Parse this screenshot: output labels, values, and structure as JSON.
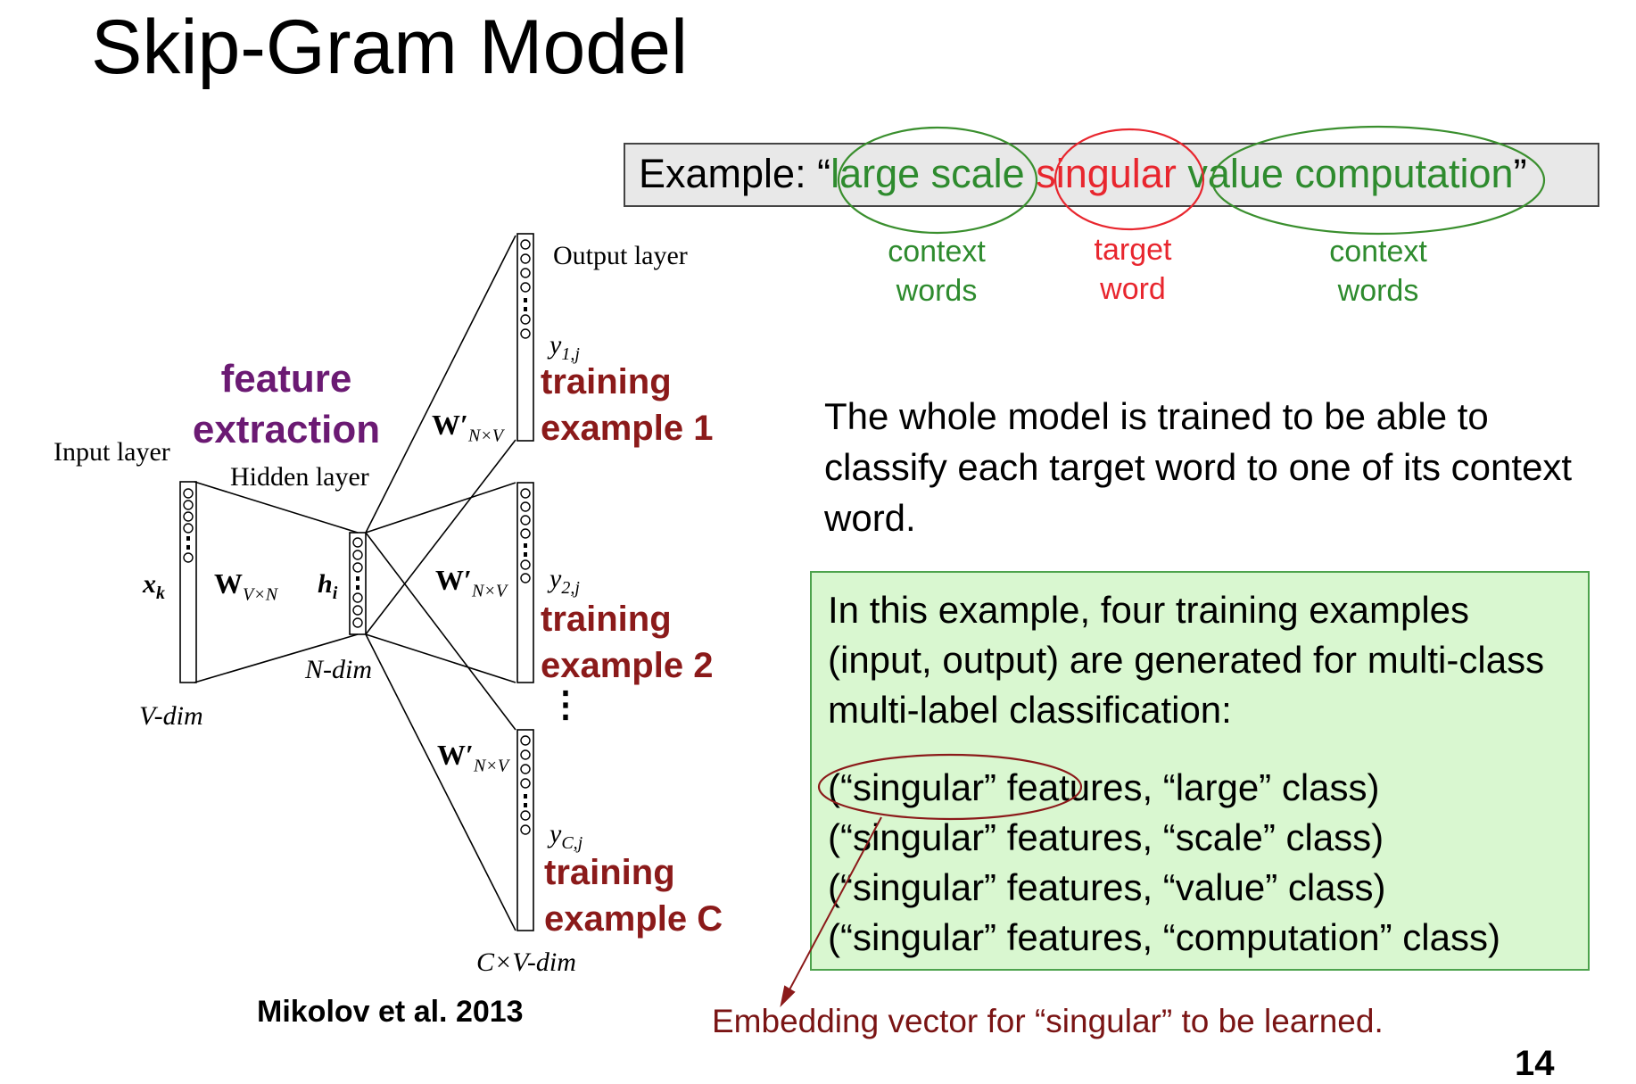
{
  "slide": {
    "title": "Skip-Gram Model",
    "example": {
      "prefix": "Example: “",
      "context_left": "large scale",
      "target": "singular",
      "context_right": "value computation",
      "suffix": "”"
    },
    "context_label_1": [
      "context",
      "words"
    ],
    "target_label": [
      "target",
      "word"
    ],
    "context_label_2": [
      "context",
      "words"
    ],
    "whole_model_text": "The whole model is trained to be able to classify each target word to one of its context word.",
    "green_box": {
      "intro": "In this example, four training examples (input, output) are generated for multi-class multi-label classification:",
      "examples": [
        "(“singular” features, “large” class)",
        "(“singular” features, “scale” class)",
        "(“singular” features, “value” class)",
        "(“singular” features, “computation” class)"
      ]
    },
    "embedding_note": "Embedding vector for “singular” to be learned.",
    "citation": "Mikolov et al. 2013",
    "page_number": "14"
  },
  "diagram": {
    "feature_extraction": [
      "feature",
      "extraction"
    ],
    "input_layer": "Input layer",
    "hidden_layer": "Hidden layer",
    "output_layer": "Output layer",
    "x_k": "x",
    "x_k_sub": "k",
    "h_i": "h",
    "h_i_sub": "i",
    "w_in": "W",
    "w_in_sub": "V×N",
    "w_out": "W′",
    "w_out_sub": "N×V",
    "v_dim": "V-dim",
    "n_dim": "N-dim",
    "cv_dim": "C×V-dim",
    "y_1": "y",
    "y_1_sub": "1,j",
    "y_2": "y",
    "y_2_sub": "2,j",
    "y_c": "y",
    "y_c_sub": "C,j",
    "training_1": [
      "training",
      "example 1"
    ],
    "training_2": [
      "training",
      "example 2"
    ],
    "training_c": [
      "training",
      "example C"
    ]
  },
  "colors": {
    "context": "#2e8b2e",
    "target": "#e8262e",
    "feature_extraction": "#6b1a73",
    "training_labels": "#8b1a1a",
    "green_box_fill": "#d9f7d0"
  }
}
